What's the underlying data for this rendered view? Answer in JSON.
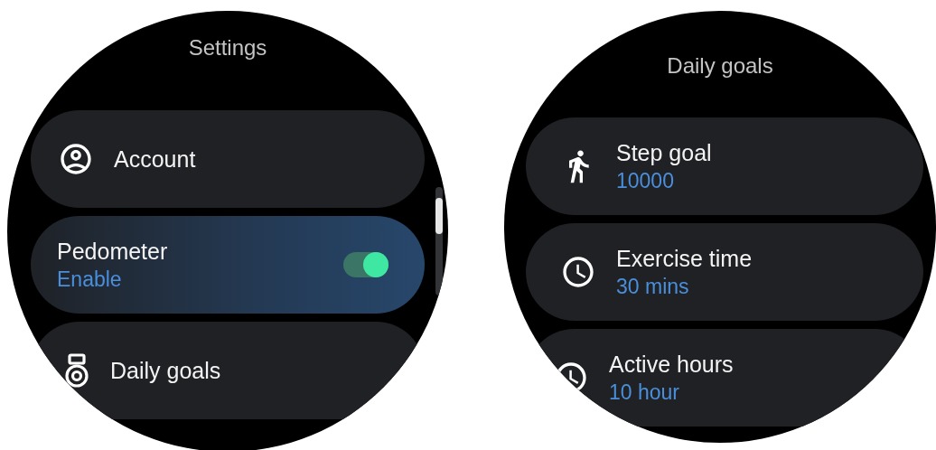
{
  "screens": [
    {
      "title": "Settings",
      "items": [
        {
          "kind": "link",
          "label": "Account"
        },
        {
          "kind": "toggle",
          "label": "Pedometer",
          "value": "Enable",
          "on": true
        },
        {
          "kind": "link",
          "label": "Daily goals"
        }
      ]
    },
    {
      "title": "Daily goals",
      "items": [
        {
          "kind": "value",
          "label": "Step goal",
          "value": "10000"
        },
        {
          "kind": "value",
          "label": "Exercise time",
          "value": "30 mins"
        },
        {
          "kind": "value",
          "label": "Active hours",
          "value": "10 hour"
        }
      ]
    }
  ]
}
